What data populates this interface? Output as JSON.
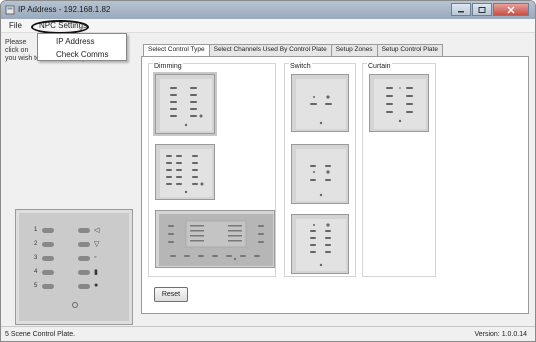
{
  "window": {
    "title": "IP Address - 192.168.1.82"
  },
  "menu": {
    "file": "File",
    "npc_settings": "NPC Settings",
    "dropdown": {
      "ip_address": "IP Address",
      "check_comms": "Check Comms"
    }
  },
  "left": {
    "instructions": [
      "Please",
      "click on",
      "you wish to create a setup file for."
    ],
    "big_plate": {
      "rows": [
        {
          "num": "1",
          "indicator": "◁"
        },
        {
          "num": "2",
          "indicator": "▽"
        },
        {
          "num": "3",
          "indicator": "◦"
        },
        {
          "num": "4",
          "indicator": "▮"
        },
        {
          "num": "5",
          "indicator": "●"
        }
      ]
    }
  },
  "tabs": [
    "Select Control Type",
    "Select Channels Used By Control Plate",
    "Setup Zones",
    "Setup Control Plate"
  ],
  "sections": {
    "dimming": "Dimming",
    "switch": "Switch",
    "curtain": "Curtain"
  },
  "reset_label": "Reset",
  "status": {
    "left": "5 Scene Control Plate.",
    "right": "Version: 1.0.0.14"
  }
}
